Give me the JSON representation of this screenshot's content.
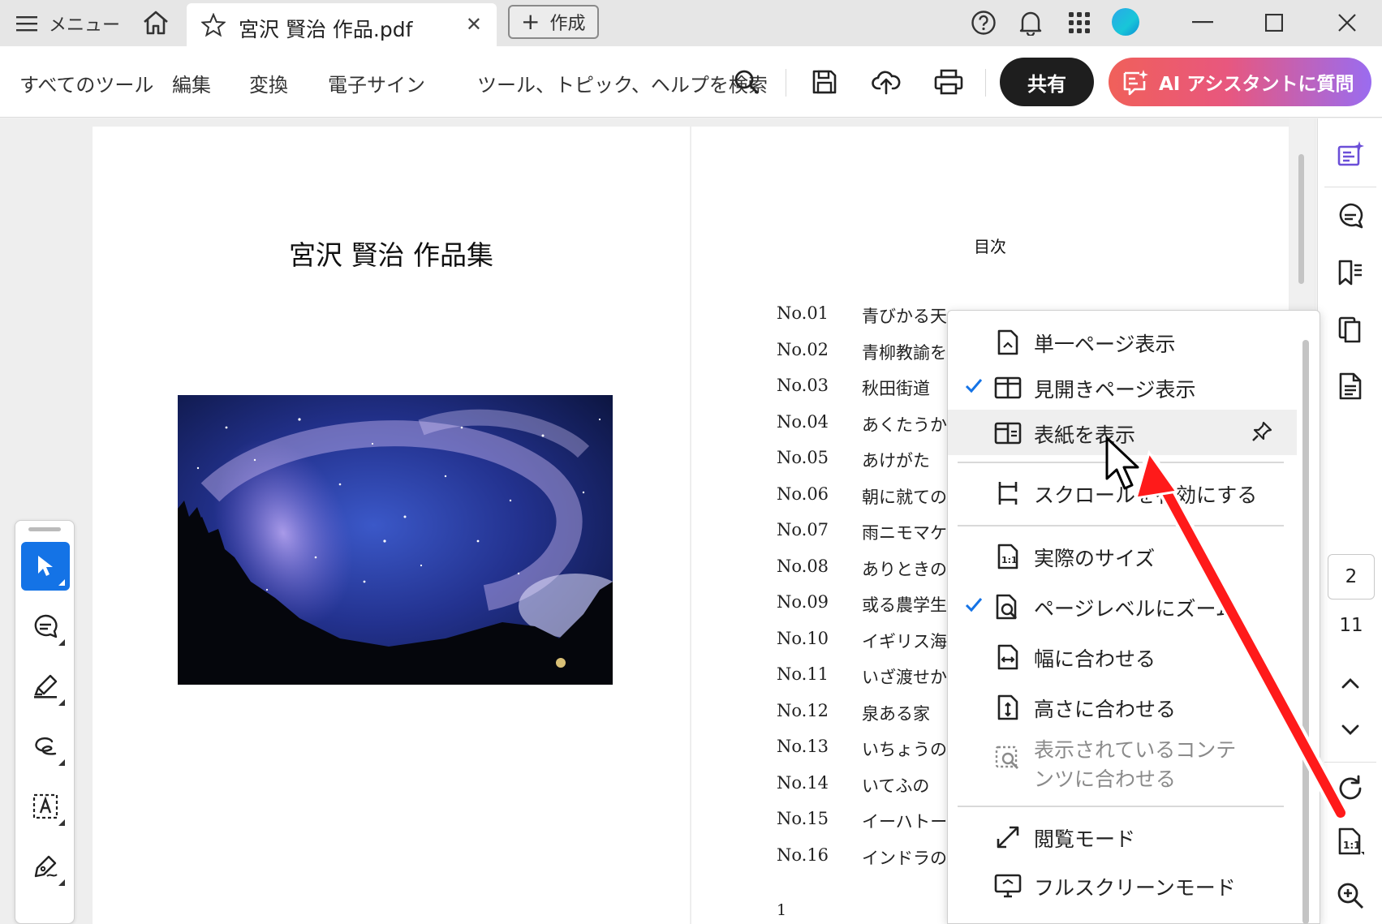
{
  "titlebar": {
    "menu_label": "メニュー",
    "tab_title": "宮沢 賢治 作品.pdf",
    "create_label": "作成",
    "icons": [
      "help-icon",
      "bell-icon",
      "apps-grid-icon"
    ]
  },
  "toolbar": {
    "all_tools": "すべてのツール",
    "edit": "編集",
    "convert": "変換",
    "esign": "電子サイン",
    "search_label": "ツール、トピック、ヘルプを検索",
    "share": "共有",
    "ai_assistant": "AI アシスタントに質問"
  },
  "document": {
    "left_page_title": "宮沢  賢治  作品集",
    "toc_title": "目次",
    "toc": [
      {
        "no": "No.01",
        "name": "青びかる天"
      },
      {
        "no": "No.02",
        "name": "青柳教諭を"
      },
      {
        "no": "No.03",
        "name": "秋田街道"
      },
      {
        "no": "No.04",
        "name": "あくたうか"
      },
      {
        "no": "No.05",
        "name": "あけがた"
      },
      {
        "no": "No.06",
        "name": "朝に就ての"
      },
      {
        "no": "No.07",
        "name": "雨ニモマケ"
      },
      {
        "no": "No.08",
        "name": "ありときの"
      },
      {
        "no": "No.09",
        "name": "或る農学生"
      },
      {
        "no": "No.10",
        "name": "イギリス海"
      },
      {
        "no": "No.11",
        "name": "いざ渡せか"
      },
      {
        "no": "No.12",
        "name": "泉ある家"
      },
      {
        "no": "No.13",
        "name": "いちょうの"
      },
      {
        "no": "No.14",
        "name": "いてふの"
      },
      {
        "no": "No.15",
        "name": "イーハトー"
      },
      {
        "no": "No.16",
        "name": "インドラの"
      }
    ],
    "page_number": "1"
  },
  "page_nav": {
    "current": "2",
    "total": "11"
  },
  "view_menu": {
    "items": [
      {
        "label": "単一ページ表示",
        "checked": false
      },
      {
        "label": "見開きページ表示",
        "checked": true
      },
      {
        "label": "表紙を表示",
        "checked": false,
        "hovered": true
      },
      {
        "label": "スクロールを有効にする",
        "checked": false
      },
      {
        "label": "実際のサイズ",
        "checked": false
      },
      {
        "label": "ページレベルにズーム",
        "checked": true
      },
      {
        "label": "幅に合わせる",
        "checked": false
      },
      {
        "label": "高さに合わせる",
        "checked": false
      },
      {
        "label": "表示されているコンテンツに合わせる",
        "checked": false,
        "disabled": true
      },
      {
        "label": "閲覧モード",
        "checked": false
      },
      {
        "label": "フルスクリーンモード",
        "checked": false
      }
    ]
  },
  "colors": {
    "accent": "#1473e6",
    "annotation_arrow": "#ff1a1a",
    "share_bg": "#1e1e1e"
  }
}
